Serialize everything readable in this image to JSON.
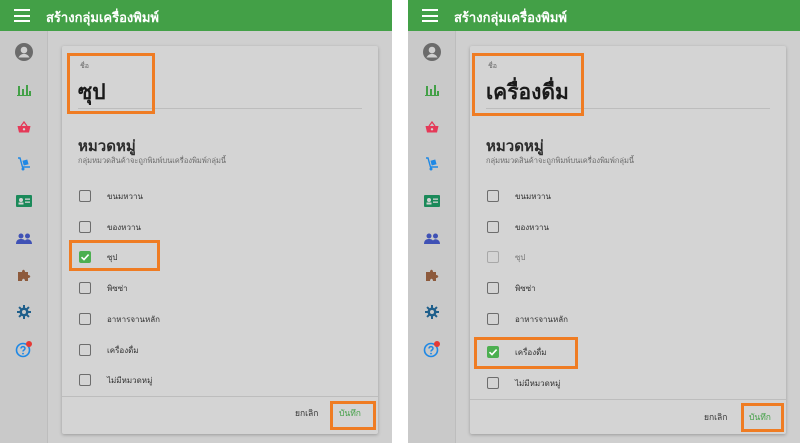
{
  "colors": {
    "appbar": "#43a047",
    "highlight": "#ef7c23",
    "checkbox_checked": "#4caf50"
  },
  "sidebar_icons": [
    "account-icon",
    "bar-chart-icon",
    "basket-icon",
    "hand-truck-icon",
    "id-card-icon",
    "people-icon",
    "puzzle-icon",
    "gear-icon",
    "help-icon"
  ],
  "panels": [
    {
      "app_title": "สร้างกลุ่มเครื่องพิมพ์",
      "name_label": "ชื่อ",
      "name_value": "ซุป",
      "section_title": "หมวดหมู่",
      "section_subtitle": "กลุ่มหมวดสินค้าจะถูกพิมพ์บนเครื่องพิมพ์กลุ่มนี้",
      "categories": [
        {
          "label": "ขนมหวาน",
          "state": "unchecked"
        },
        {
          "label": "ของหวาน",
          "state": "unchecked"
        },
        {
          "label": "ซุป",
          "state": "checked"
        },
        {
          "label": "พิซซ่า",
          "state": "unchecked"
        },
        {
          "label": "อาหารจานหลัก",
          "state": "unchecked"
        },
        {
          "label": "เครื่องดื่ม",
          "state": "unchecked"
        },
        {
          "label": "ไม่มีหมวดหมู่",
          "state": "unchecked"
        }
      ],
      "cancel_label": "ยกเลิก",
      "save_label": "บันทึก"
    },
    {
      "app_title": "สร้างกลุ่มเครื่องพิมพ์",
      "name_label": "ชื่อ",
      "name_value": "เครื่องดื่ม",
      "section_title": "หมวดหมู่",
      "section_subtitle": "กลุ่มหมวดสินค้าจะถูกพิมพ์บนเครื่องพิมพ์กลุ่มนี้",
      "categories": [
        {
          "label": "ขนมหวาน",
          "state": "unchecked"
        },
        {
          "label": "ของหวาน",
          "state": "unchecked"
        },
        {
          "label": "ซุป",
          "state": "disabled"
        },
        {
          "label": "พิซซ่า",
          "state": "unchecked"
        },
        {
          "label": "อาหารจานหลัก",
          "state": "unchecked"
        },
        {
          "label": "เครื่องดื่ม",
          "state": "checked"
        },
        {
          "label": "ไม่มีหมวดหมู่",
          "state": "unchecked"
        }
      ],
      "cancel_label": "ยกเลิก",
      "save_label": "บันทึก"
    }
  ]
}
